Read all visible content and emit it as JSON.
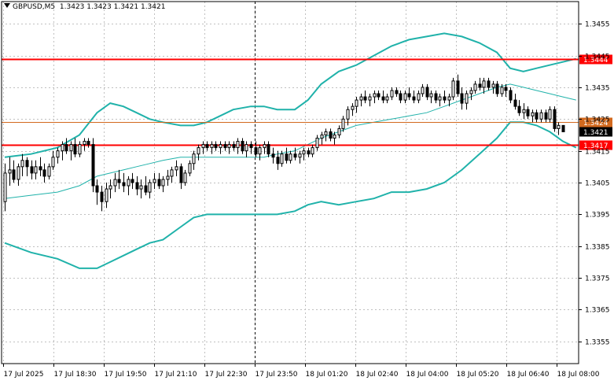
{
  "header": {
    "symbol": "GBPUSD,M5",
    "ohlc": "1.3423 1.3423 1.3421 1.3421"
  },
  "colors": {
    "background": "#ffffff",
    "grid": "#c0c0c0",
    "candle": "#000000",
    "bollinger": "#20b2aa",
    "level_red": "#ff0000",
    "level_orange": "#d2691e",
    "current_price_bg": "#000000"
  },
  "chart_data": {
    "type": "candlestick",
    "title": "GBPUSD,M5",
    "ylim": [
      1.3348,
      1.3462
    ],
    "grid": true,
    "y_ticks": [
      "1.3455",
      "1.3445",
      "1.3435",
      "1.3425",
      "1.3415",
      "1.3405",
      "1.3395",
      "1.3385",
      "1.3375",
      "1.3365",
      "1.3355"
    ],
    "x_ticks": [
      "17 Jul 2025",
      "17 Jul 18:30",
      "17 Jul 19:50",
      "17 Jul 21:10",
      "17 Jul 22:30",
      "17 Jul 23:50",
      "18 Jul 01:20",
      "18 Jul 02:40",
      "18 Jul 04:00",
      "18 Jul 05:20",
      "18 Jul 06:40",
      "18 Jul 08:00"
    ],
    "vertical_marker": "17 Jul 23:50",
    "levels": [
      {
        "price": 1.3444,
        "label": "1.3444",
        "color": "red"
      },
      {
        "price": 1.3417,
        "label": "1.3417",
        "color": "red"
      },
      {
        "price": 1.3424,
        "label": "1.3424",
        "color": "orange"
      }
    ],
    "current_price": {
      "price": 1.3421,
      "label": "1.3421"
    },
    "bollinger": {
      "upper": [
        [
          0,
          1.3413
        ],
        [
          6,
          1.3414
        ],
        [
          12,
          1.3416
        ],
        [
          17,
          1.342
        ],
        [
          21,
          1.3427
        ],
        [
          24,
          1.343
        ],
        [
          27,
          1.3429
        ],
        [
          30,
          1.3427
        ],
        [
          33,
          1.3425
        ],
        [
          36,
          1.3424
        ],
        [
          40,
          1.3423
        ],
        [
          43,
          1.3423
        ],
        [
          46,
          1.3424
        ],
        [
          49,
          1.3426
        ],
        [
          52,
          1.3428
        ],
        [
          56,
          1.3429
        ],
        [
          59,
          1.3429
        ],
        [
          62,
          1.3428
        ],
        [
          66,
          1.3428
        ],
        [
          69,
          1.3431
        ],
        [
          72,
          1.3436
        ],
        [
          76,
          1.344
        ],
        [
          80,
          1.3442
        ],
        [
          84,
          1.3445
        ],
        [
          88,
          1.3448
        ],
        [
          92,
          1.345
        ],
        [
          96,
          1.3451
        ],
        [
          100,
          1.3452
        ],
        [
          104,
          1.3451
        ],
        [
          108,
          1.3449
        ],
        [
          112,
          1.3446
        ],
        [
          115,
          1.3441
        ],
        [
          118,
          1.344
        ],
        [
          121,
          1.3441
        ],
        [
          124,
          1.3442
        ],
        [
          127,
          1.3443
        ],
        [
          130,
          1.3444
        ]
      ],
      "middle": [
        [
          0,
          1.34
        ],
        [
          6,
          1.3401
        ],
        [
          12,
          1.3402
        ],
        [
          17,
          1.3404
        ],
        [
          21,
          1.3407
        ],
        [
          24,
          1.3408
        ],
        [
          27,
          1.3409
        ],
        [
          30,
          1.341
        ],
        [
          33,
          1.3411
        ],
        [
          36,
          1.3412
        ],
        [
          40,
          1.3413
        ],
        [
          43,
          1.3413
        ],
        [
          46,
          1.3413
        ],
        [
          49,
          1.3413
        ],
        [
          52,
          1.3413
        ],
        [
          56,
          1.3413
        ],
        [
          59,
          1.3413
        ],
        [
          62,
          1.3414
        ],
        [
          66,
          1.3415
        ],
        [
          69,
          1.3417
        ],
        [
          72,
          1.3419
        ],
        [
          76,
          1.3421
        ],
        [
          80,
          1.3423
        ],
        [
          84,
          1.3424
        ],
        [
          88,
          1.3425
        ],
        [
          92,
          1.3426
        ],
        [
          96,
          1.3427
        ],
        [
          100,
          1.3429
        ],
        [
          104,
          1.3431
        ],
        [
          108,
          1.3433
        ],
        [
          112,
          1.3435
        ],
        [
          115,
          1.3436
        ],
        [
          118,
          1.3435
        ],
        [
          121,
          1.3434
        ],
        [
          124,
          1.3433
        ],
        [
          127,
          1.3432
        ],
        [
          130,
          1.3431
        ]
      ],
      "lower": [
        [
          0,
          1.3386
        ],
        [
          6,
          1.3383
        ],
        [
          12,
          1.3381
        ],
        [
          17,
          1.3378
        ],
        [
          21,
          1.3378
        ],
        [
          24,
          1.338
        ],
        [
          27,
          1.3382
        ],
        [
          30,
          1.3384
        ],
        [
          33,
          1.3386
        ],
        [
          36,
          1.3387
        ],
        [
          40,
          1.3391
        ],
        [
          43,
          1.3394
        ],
        [
          46,
          1.3395
        ],
        [
          49,
          1.3395
        ],
        [
          52,
          1.3395
        ],
        [
          56,
          1.3395
        ],
        [
          59,
          1.3395
        ],
        [
          62,
          1.3395
        ],
        [
          66,
          1.3396
        ],
        [
          69,
          1.3398
        ],
        [
          72,
          1.3399
        ],
        [
          76,
          1.3398
        ],
        [
          80,
          1.3399
        ],
        [
          84,
          1.34
        ],
        [
          88,
          1.3402
        ],
        [
          92,
          1.3402
        ],
        [
          96,
          1.3403
        ],
        [
          100,
          1.3405
        ],
        [
          104,
          1.3409
        ],
        [
          108,
          1.3414
        ],
        [
          112,
          1.3419
        ],
        [
          115,
          1.3424
        ],
        [
          118,
          1.3424
        ],
        [
          121,
          1.3423
        ],
        [
          124,
          1.3421
        ],
        [
          127,
          1.3418
        ],
        [
          130,
          1.3416
        ]
      ]
    },
    "candles": [
      [
        1.3399,
        1.3411,
        1.3396,
        1.3408
      ],
      [
        1.3408,
        1.3413,
        1.3404,
        1.3409
      ],
      [
        1.3409,
        1.3412,
        1.3405,
        1.3406
      ],
      [
        1.3406,
        1.3411,
        1.3404,
        1.341
      ],
      [
        1.341,
        1.3414,
        1.3407,
        1.3412
      ],
      [
        1.3412,
        1.3413,
        1.3407,
        1.341
      ],
      [
        1.341,
        1.3412,
        1.3406,
        1.3408
      ],
      [
        1.3408,
        1.3412,
        1.3406,
        1.341
      ],
      [
        1.341,
        1.3413,
        1.3407,
        1.3409
      ],
      [
        1.3409,
        1.3411,
        1.3405,
        1.3407
      ],
      [
        1.3407,
        1.3411,
        1.3406,
        1.341
      ],
      [
        1.341,
        1.3415,
        1.3409,
        1.3413
      ],
      [
        1.3413,
        1.3416,
        1.3411,
        1.3415
      ],
      [
        1.3415,
        1.3418,
        1.3412,
        1.3417
      ],
      [
        1.3417,
        1.3419,
        1.3414,
        1.3415
      ],
      [
        1.3415,
        1.3418,
        1.3412,
        1.3417
      ],
      [
        1.3417,
        1.3419,
        1.3413,
        1.3414
      ],
      [
        1.3414,
        1.3418,
        1.3413,
        1.3417
      ],
      [
        1.3417,
        1.3419,
        1.3415,
        1.3418
      ],
      [
        1.3418,
        1.3419,
        1.3416,
        1.3417
      ],
      [
        1.3417,
        1.3419,
        1.3402,
        1.3404
      ],
      [
        1.3404,
        1.3406,
        1.3398,
        1.3402
      ],
      [
        1.3402,
        1.3404,
        1.3396,
        1.3399
      ],
      [
        1.3399,
        1.3405,
        1.3397,
        1.3403
      ],
      [
        1.3403,
        1.3406,
        1.34,
        1.3404
      ],
      [
        1.3404,
        1.3408,
        1.3402,
        1.3406
      ],
      [
        1.3406,
        1.3409,
        1.3403,
        1.3405
      ],
      [
        1.3405,
        1.3408,
        1.3402,
        1.3404
      ],
      [
        1.3404,
        1.3407,
        1.3401,
        1.3406
      ],
      [
        1.3406,
        1.3408,
        1.3403,
        1.3405
      ],
      [
        1.3405,
        1.3407,
        1.3401,
        1.3403
      ],
      [
        1.3403,
        1.3406,
        1.34,
        1.3404
      ],
      [
        1.3404,
        1.3407,
        1.3401,
        1.3402
      ],
      [
        1.3402,
        1.3406,
        1.34,
        1.3405
      ],
      [
        1.3405,
        1.3408,
        1.3403,
        1.3406
      ],
      [
        1.3406,
        1.3408,
        1.3403,
        1.3404
      ],
      [
        1.3404,
        1.3407,
        1.3402,
        1.3406
      ],
      [
        1.3406,
        1.3409,
        1.3404,
        1.3407
      ],
      [
        1.3407,
        1.341,
        1.3405,
        1.3409
      ],
      [
        1.3409,
        1.3412,
        1.3407,
        1.341
      ],
      [
        1.341,
        1.3411,
        1.3403,
        1.3405
      ],
      [
        1.3405,
        1.3409,
        1.3404,
        1.3408
      ],
      [
        1.3408,
        1.3412,
        1.3407,
        1.3411
      ],
      [
        1.3411,
        1.3415,
        1.3409,
        1.3414
      ],
      [
        1.3414,
        1.3417,
        1.3412,
        1.3416
      ],
      [
        1.3416,
        1.3418,
        1.3414,
        1.3417
      ],
      [
        1.3417,
        1.3418,
        1.3415,
        1.3416
      ],
      [
        1.3416,
        1.3418,
        1.3414,
        1.3417
      ],
      [
        1.3417,
        1.3418,
        1.3415,
        1.3416
      ],
      [
        1.3416,
        1.3418,
        1.3414,
        1.3417
      ],
      [
        1.3417,
        1.3418,
        1.3415,
        1.3416
      ],
      [
        1.3416,
        1.3418,
        1.3414,
        1.3417
      ],
      [
        1.3417,
        1.3418,
        1.3415,
        1.3416
      ],
      [
        1.3416,
        1.3419,
        1.3414,
        1.3418
      ],
      [
        1.3418,
        1.3419,
        1.3414,
        1.3415
      ],
      [
        1.3415,
        1.3418,
        1.3413,
        1.3417
      ],
      [
        1.3417,
        1.3418,
        1.3414,
        1.3416
      ],
      [
        1.3416,
        1.3418,
        1.3413,
        1.3414
      ],
      [
        1.3414,
        1.3417,
        1.3412,
        1.3416
      ],
      [
        1.3416,
        1.3418,
        1.3414,
        1.3417
      ],
      [
        1.3417,
        1.3418,
        1.3413,
        1.3414
      ],
      [
        1.3414,
        1.3416,
        1.3411,
        1.3413
      ],
      [
        1.3413,
        1.3415,
        1.3409,
        1.3411
      ],
      [
        1.3411,
        1.3415,
        1.341,
        1.3414
      ],
      [
        1.3414,
        1.3416,
        1.3411,
        1.3412
      ],
      [
        1.3412,
        1.3415,
        1.3411,
        1.3414
      ],
      [
        1.3414,
        1.3416,
        1.3412,
        1.3413
      ],
      [
        1.3413,
        1.3415,
        1.3411,
        1.3414
      ],
      [
        1.3414,
        1.3416,
        1.3412,
        1.3415
      ],
      [
        1.3415,
        1.3416,
        1.3413,
        1.3414
      ],
      [
        1.3414,
        1.3417,
        1.3413,
        1.3416
      ],
      [
        1.3416,
        1.342,
        1.3415,
        1.3419
      ],
      [
        1.3419,
        1.3421,
        1.3417,
        1.342
      ],
      [
        1.342,
        1.3422,
        1.3418,
        1.3421
      ],
      [
        1.3421,
        1.3422,
        1.3418,
        1.3419
      ],
      [
        1.3419,
        1.3421,
        1.3417,
        1.342
      ],
      [
        1.342,
        1.3423,
        1.3419,
        1.3422
      ],
      [
        1.3422,
        1.3426,
        1.3421,
        1.3425
      ],
      [
        1.3425,
        1.3429,
        1.3423,
        1.3428
      ],
      [
        1.3428,
        1.343,
        1.3426,
        1.3429
      ],
      [
        1.3429,
        1.3432,
        1.3427,
        1.3431
      ],
      [
        1.3431,
        1.3433,
        1.3429,
        1.3432
      ],
      [
        1.3432,
        1.3434,
        1.343,
        1.3431
      ],
      [
        1.3431,
        1.3433,
        1.3429,
        1.3432
      ],
      [
        1.3432,
        1.3434,
        1.343,
        1.3433
      ],
      [
        1.3433,
        1.3434,
        1.3431,
        1.3432
      ],
      [
        1.3432,
        1.3434,
        1.343,
        1.3431
      ],
      [
        1.3431,
        1.3433,
        1.343,
        1.3432
      ],
      [
        1.3432,
        1.3435,
        1.3431,
        1.3434
      ],
      [
        1.3434,
        1.3435,
        1.3432,
        1.3433
      ],
      [
        1.3433,
        1.3434,
        1.343,
        1.3431
      ],
      [
        1.3431,
        1.3434,
        1.343,
        1.3433
      ],
      [
        1.3433,
        1.3435,
        1.3431,
        1.3432
      ],
      [
        1.3432,
        1.3434,
        1.343,
        1.3431
      ],
      [
        1.3431,
        1.3434,
        1.343,
        1.3433
      ],
      [
        1.3433,
        1.3436,
        1.3432,
        1.3435
      ],
      [
        1.3435,
        1.3436,
        1.3431,
        1.3432
      ],
      [
        1.3432,
        1.3434,
        1.343,
        1.3433
      ],
      [
        1.3433,
        1.3434,
        1.343,
        1.3431
      ],
      [
        1.3431,
        1.3433,
        1.3429,
        1.3432
      ],
      [
        1.3432,
        1.3434,
        1.343,
        1.3431
      ],
      [
        1.3431,
        1.3433,
        1.3429,
        1.3432
      ],
      [
        1.3432,
        1.3438,
        1.3431,
        1.3437
      ],
      [
        1.3437,
        1.3439,
        1.3432,
        1.3433
      ],
      [
        1.3433,
        1.3435,
        1.3428,
        1.343
      ],
      [
        1.343,
        1.3434,
        1.3428,
        1.3433
      ],
      [
        1.3433,
        1.3435,
        1.3431,
        1.3434
      ],
      [
        1.3434,
        1.3437,
        1.3433,
        1.3436
      ],
      [
        1.3436,
        1.3438,
        1.3434,
        1.3435
      ],
      [
        1.3435,
        1.3438,
        1.3433,
        1.3437
      ],
      [
        1.3437,
        1.3438,
        1.3434,
        1.3435
      ],
      [
        1.3435,
        1.3437,
        1.3433,
        1.3436
      ],
      [
        1.3436,
        1.3437,
        1.3432,
        1.3433
      ],
      [
        1.3433,
        1.3436,
        1.3432,
        1.3435
      ],
      [
        1.3435,
        1.3436,
        1.3432,
        1.3434
      ],
      [
        1.3434,
        1.3435,
        1.343,
        1.3431
      ],
      [
        1.3431,
        1.3433,
        1.3428,
        1.3429
      ],
      [
        1.3429,
        1.3431,
        1.3426,
        1.3427
      ],
      [
        1.3427,
        1.343,
        1.3425,
        1.3428
      ],
      [
        1.3428,
        1.3429,
        1.3425,
        1.3426
      ],
      [
        1.3426,
        1.3428,
        1.3424,
        1.3427
      ],
      [
        1.3427,
        1.3428,
        1.3424,
        1.3425
      ],
      [
        1.3425,
        1.3428,
        1.3424,
        1.3427
      ],
      [
        1.3427,
        1.3428,
        1.3424,
        1.3425
      ],
      [
        1.3425,
        1.3429,
        1.3424,
        1.3428
      ],
      [
        1.3428,
        1.3429,
        1.3421,
        1.3422
      ],
      [
        1.3422,
        1.3424,
        1.342,
        1.3423
      ],
      [
        1.3423,
        1.3423,
        1.3421,
        1.3421
      ]
    ]
  }
}
